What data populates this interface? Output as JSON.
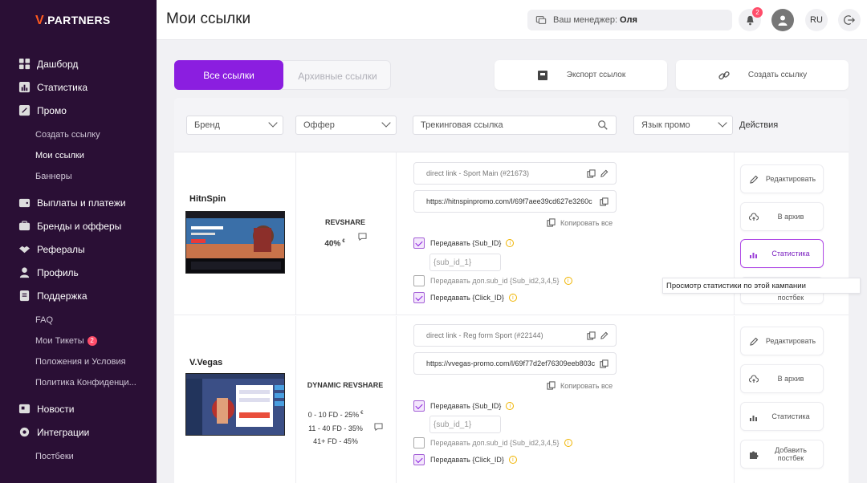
{
  "sidebar": {
    "logo": {
      "mark": "V",
      "text": ".PARTNERS"
    },
    "items": {
      "dashboard": "Дашборд",
      "stats": "Статистика",
      "promo": "Промо",
      "create_link": "Создать ссылку",
      "my_links": "Мои ссылки",
      "banners": "Баннеры",
      "payouts": "Выплаты и платежи",
      "brands": "Бренды и офферы",
      "referrals": "Рефералы",
      "profile": "Профиль",
      "support": "Поддержка",
      "faq": "FAQ",
      "tickets": "Мои Тикеты",
      "tickets_badge": "2",
      "terms": "Положения и Условия",
      "privacy": "Политика Конфиденци...",
      "news": "Новости",
      "integrations": "Интеграции",
      "postbacks": "Постбеки"
    }
  },
  "header": {
    "title": "Мои ссылки",
    "manager_label": "Ваш менеджер:",
    "manager_name": "Оля",
    "notifications": "2",
    "language": "RU"
  },
  "tabs": {
    "all": "Все ссылки",
    "archived": "Архивные ссылки"
  },
  "actions": {
    "export": "Экспорт ссылок",
    "create": "Создать ссылку"
  },
  "filters": {
    "brand": "Бренд",
    "offer": "Оффер",
    "tracking": "Трекинговая ссылка",
    "language": "Язык промо",
    "actions": "Действия"
  },
  "rows": [
    {
      "brand": "HitnSpin",
      "offer_title": "REVSHARE",
      "offer_lines": [
        "40%"
      ],
      "currency": "€",
      "link_name": "direct link - Sport Main (#21673)",
      "url": "https://hitnspinpromo.com/l/69f7aee39cd627e3260c",
      "copy_all": "Копировать все",
      "subid_label": "Передавать {Sub_ID}",
      "subid_placeholder": "{sub_id_1}",
      "extra_subid_label": "Передавать доп.sub_id {Sub_id2,3,4,5}",
      "clickid_label": "Передавать {Click_ID}",
      "buttons": {
        "edit": "Редактировать",
        "archive": "В архив",
        "stats": "Статистика",
        "postback_partial": "постбек"
      }
    },
    {
      "brand": "V.Vegas",
      "offer_title": "DYNAMIC REVSHARE",
      "offer_lines": [
        "0 - 10 FD - 25%",
        "11 - 40 FD - 35%",
        "41+ FD - 45%"
      ],
      "currency": "€",
      "link_name": "direct link - Reg form Sport (#22144)",
      "url": "https://vvegas-promo.com/l/69f77d2ef76309eeb803c",
      "copy_all": "Копировать все",
      "subid_label": "Передавать {Sub_ID}",
      "subid_placeholder": "{sub_id_1}",
      "extra_subid_label": "Передавать доп.sub_id {Sub_id2,3,4,5}",
      "clickid_label": "Передавать {Click_ID}",
      "buttons": {
        "edit": "Редактировать",
        "archive": "В архив",
        "stats": "Статистика",
        "add_postback": "Добавить постбек"
      }
    }
  ],
  "tooltip": "Просмотр статистики по этой кампании",
  "colors": {
    "sidebar": "#2a0f35",
    "accent": "#8b1ee0",
    "badge": "#ff4d6a",
    "logo_mark": "#ff5a1f"
  }
}
